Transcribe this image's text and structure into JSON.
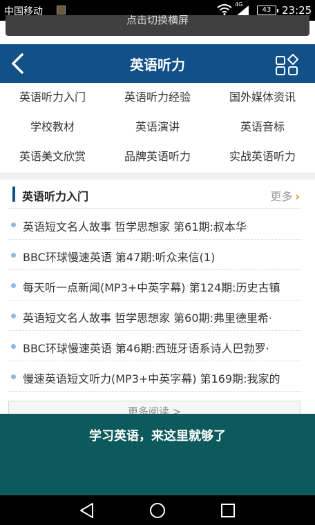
{
  "status_bar": {
    "carrier": "中国移动",
    "network": "4G",
    "battery": "43",
    "time": "23:25"
  },
  "toast": {
    "text": "点击切换横屏"
  },
  "header": {
    "title": "英语听力",
    "back_icon": "chevron-left-icon",
    "menu_icon": "grid-menu-icon"
  },
  "categories": [
    "英语听力入门",
    "英语听力经验",
    "国外媒体资讯",
    "学校教材",
    "英语演讲",
    "英语音标",
    "英语美文欣赏",
    "品牌英语听力",
    "实战英语听力"
  ],
  "section": {
    "title": "英语听力入门",
    "more_label": "更多",
    "items": [
      "英语短文名人故事 哲学思想家 第61期:叔本华",
      "BBC环球慢速英语 第47期:听众来信(1)",
      "每天听一点新闻(MP3+中英字幕) 第124期:历史古镇",
      "英语短文名人故事 哲学思想家 第60期:弗里德里希·",
      "BBC环球慢速英语 第46期:西班牙语系诗人巴勃罗·",
      "慢速英语短文听力(MP3+中英字幕) 第169期:我家的"
    ],
    "more_read": "更多阅读 >"
  },
  "banner": {
    "text": "学习英语，来这里就够了"
  },
  "nav": {
    "icons": [
      "back-triangle-icon",
      "home-circle-icon",
      "recents-square-icon"
    ]
  },
  "colors": {
    "header": "#12508a",
    "banner": "#0c5a5c",
    "accent": "#f08a00"
  }
}
